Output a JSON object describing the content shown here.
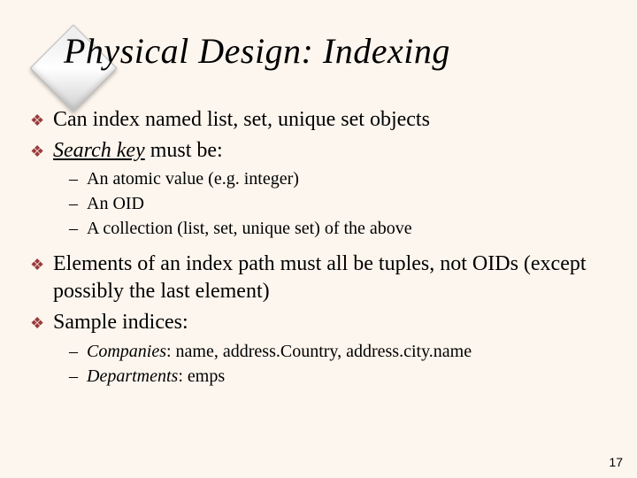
{
  "title": "Physical Design:  Indexing",
  "bullets": {
    "b1": "Can index named list, set, unique set objects",
    "b2_prefix": "Search key",
    "b2_suffix": " must be:",
    "s1": "An atomic value (e.g. integer)",
    "s2": "An OID",
    "s3": "A collection (list, set, unique set) of the above",
    "b3": "Elements of an index path must all be tuples, not OIDs (except possibly the last element)",
    "b4": "Sample indices:",
    "s4_prefix": "Companies",
    "s4_suffix": ":  name, address.Country, address.city.name",
    "s5_prefix": "Departments",
    "s5_suffix": ":  emps"
  },
  "glyphs": {
    "diamond_bullet": "❖",
    "dash": "–"
  },
  "page_number": "17",
  "colors": {
    "background": "#fdf6ee",
    "bullet": "#9a3b3b"
  }
}
